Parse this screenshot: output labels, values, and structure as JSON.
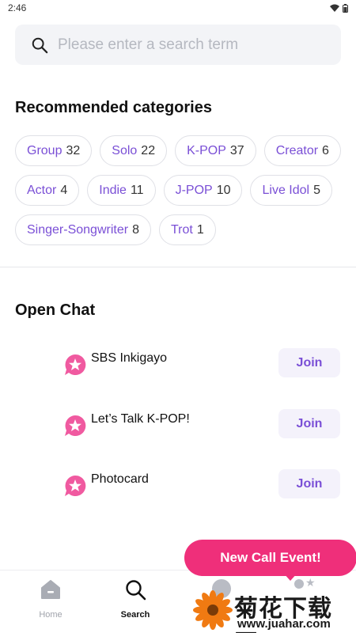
{
  "status_bar": {
    "time": "2:46"
  },
  "search": {
    "placeholder": "Please enter a search term"
  },
  "categories": {
    "title": "Recommended categories",
    "items": [
      {
        "name": "Group",
        "count": "32"
      },
      {
        "name": "Solo",
        "count": "22"
      },
      {
        "name": "K-POP",
        "count": "37"
      },
      {
        "name": "Creator",
        "count": "6"
      },
      {
        "name": "Actor",
        "count": "4"
      },
      {
        "name": "Indie",
        "count": "11"
      },
      {
        "name": "J-POP",
        "count": "10"
      },
      {
        "name": "Live Idol",
        "count": "5"
      },
      {
        "name": "Singer-Songwriter",
        "count": "8"
      },
      {
        "name": "Trot",
        "count": "1"
      }
    ]
  },
  "open_chat": {
    "title": "Open Chat",
    "join_label": "Join",
    "items": [
      {
        "name": "SBS Inkigayo"
      },
      {
        "name": "Let’s Talk K-POP!"
      },
      {
        "name": "Photocard"
      }
    ]
  },
  "event": {
    "label": "New Call Event!"
  },
  "nav": {
    "home": "Home",
    "search": "Search"
  },
  "watermark": {
    "text": "菊花下载网",
    "url": "www.juahar.com"
  },
  "colors": {
    "accent": "#7a4fd6",
    "event_pink": "#ef2f7a",
    "chat_icon_pink": "#f05aa0"
  }
}
